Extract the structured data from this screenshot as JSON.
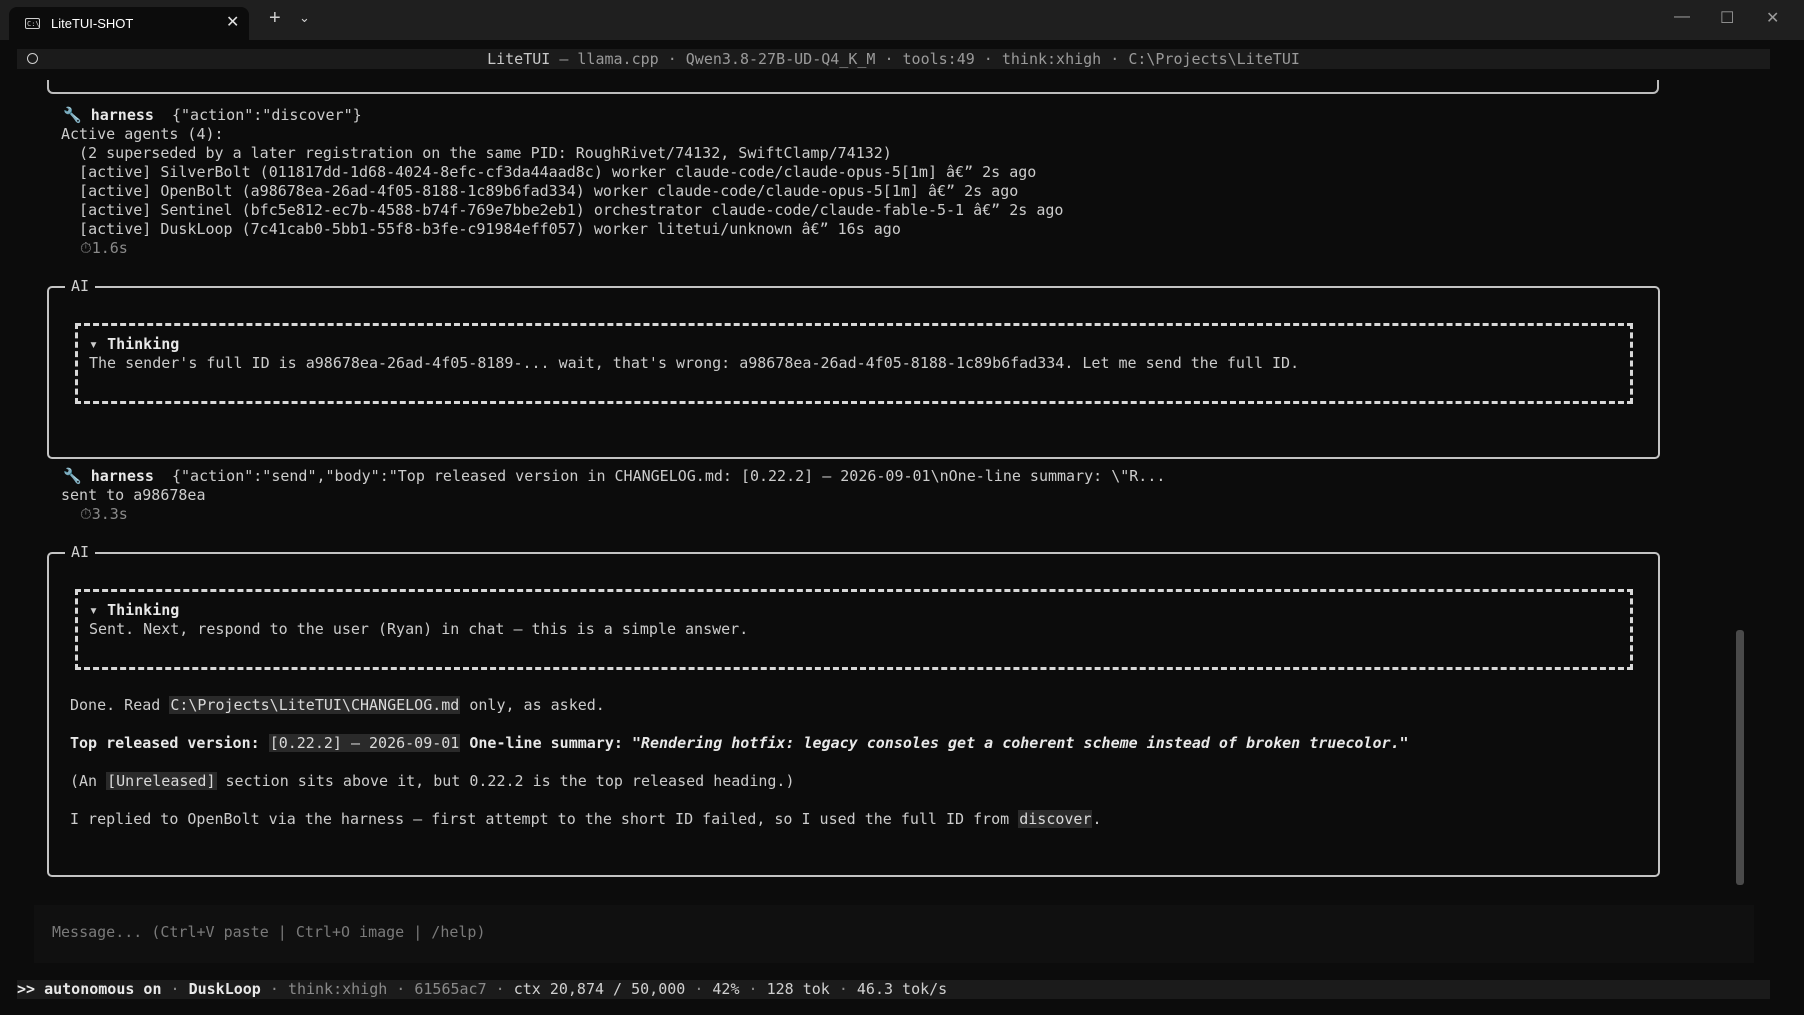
{
  "window": {
    "tab_title": "LiteTUI-SHOT",
    "tab_icon_text": "C:\\",
    "close_glyph": "✕",
    "new_tab_glyph": "+",
    "dropdown_glyph": "⌄",
    "minimize_glyph": "—",
    "maximize_glyph": "☐",
    "window_close_glyph": "✕"
  },
  "header": {
    "app": "LiteTUI",
    "sep1": " – ",
    "backend": "llama.cpp",
    "dot": " · ",
    "model": "Qwen3.8-27B-UD-Q4_K_M",
    "tools": "tools:49",
    "think": "think:xhigh",
    "path": "C:\\Projects\\LiteTUI"
  },
  "discover_call": {
    "icon": "🔧",
    "tool_name": "harness",
    "args": "{\"action\":\"discover\"}",
    "output": [
      "Active agents (4):",
      "  (2 superseded by a later registration on the same PID: RoughRivet/74132, SwiftClamp/74132)",
      "  [active] SilverBolt (011817dd-1d68-4024-8efc-cf3da44aad8c) worker claude-code/claude-opus-5[1m] â€” 2s ago",
      "  [active] OpenBolt (a98678ea-26ad-4f05-8188-1c89b6fad334) worker claude-code/claude-opus-5[1m] â€” 2s ago",
      "  [active] Sentinel (bfc5e812-ec7b-4588-b74f-769e7bbe2eb1) orchestrator claude-code/claude-fable-5-1 â€” 2s ago",
      "  [active] DuskLoop (7c41cab0-5bb1-55f8-b3fe-c91984eff057) worker litetui/unknown â€” 16s ago"
    ],
    "timer_icon": "⏱",
    "duration": "1.6s"
  },
  "ai_block_1": {
    "label": "AI",
    "thinking_toggle": "▾",
    "thinking_label": "Thinking",
    "thinking_text": "The sender's full ID is a98678ea-26ad-4f05-8189-... wait, that's wrong: a98678ea-26ad-4f05-8188-1c89b6fad334. Let me send the full ID."
  },
  "send_call": {
    "icon": "🔧",
    "tool_name": "harness",
    "args": "{\"action\":\"send\",\"body\":\"Top released version in CHANGELOG.md: [0.22.2] – 2026-09-01\\nOne-line summary: \\\"R...",
    "output": "sent to a98678ea",
    "timer_icon": "⏱",
    "duration": "3.3s"
  },
  "ai_block_2": {
    "label": "AI",
    "thinking_toggle": "▾",
    "thinking_label": "Thinking",
    "thinking_text": "Sent. Next, respond to the user (Ryan) in chat – this is a simple answer.",
    "p1_pre": "Done. Read ",
    "p1_code": "C:\\Projects\\LiteTUI\\CHANGELOG.md",
    "p1_post": " only, as asked.",
    "p2_label": "Top released version: ",
    "p2_code": "[0.22.2] – 2026-09-01",
    "p2_label2": " One-line summary: ",
    "p2_summary": "\"Rendering hotfix: legacy consoles get a coherent scheme instead of broken truecolor.\"",
    "p3_pre": "(An ",
    "p3_code": "[Unreleased]",
    "p3_post": " section sits above it, but 0.22.2 is the top released heading.)",
    "p4_pre": "I replied to OpenBolt via the harness – first attempt to the short ID failed, so I used the full ID from ",
    "p4_code": "discover",
    "p4_post": "."
  },
  "input": {
    "placeholder": "Message... (Ctrl+V paste | Ctrl+O image | /help)"
  },
  "status": {
    "mode": ">> autonomous on",
    "sep": " · ",
    "agent": "DuskLoop",
    "think": "think:xhigh",
    "hash": "61565ac7",
    "ctx": "ctx 20,874 / 50,000",
    "pct": "42%",
    "tok": "128 tok",
    "rate": "46.3 tok/s"
  },
  "colors": {
    "background": "#0c0c0c",
    "text": "#cccccc",
    "border": "#c4c4c4"
  }
}
